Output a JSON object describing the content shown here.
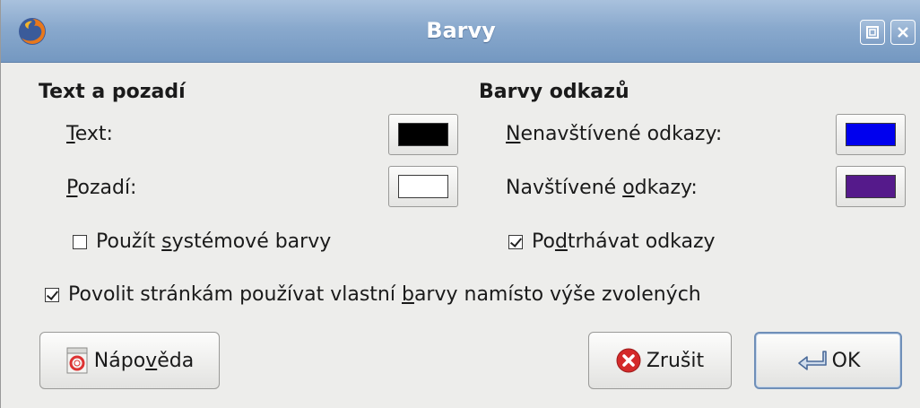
{
  "window": {
    "title": "Barvy"
  },
  "text_background": {
    "heading": "Text a pozadí",
    "text_label_u": "T",
    "text_label_rest": "ext:",
    "bg_label_u": "P",
    "bg_label_rest": "ozadí:",
    "text_color": "#000000",
    "bg_color": "#ffffff",
    "system_colors": {
      "pre": "Použít ",
      "u": "s",
      "post": "ystémové barvy",
      "checked": false
    }
  },
  "link_colors": {
    "heading": "Barvy odkazů",
    "unvisited_u": "N",
    "unvisited_rest": "enavštívené odkazy:",
    "visited_pre": "Navštívené ",
    "visited_u": "o",
    "visited_post": "dkazy:",
    "unvisited_color": "#0000ee",
    "visited_color": "#551a8b",
    "underline": {
      "pre": "Po",
      "u": "d",
      "post": "trhávat odkazy",
      "checked": true
    }
  },
  "allow_page_colors": {
    "pre": "Povolit stránkám používat vlastní ",
    "u": "b",
    "post": "arvy namísto výše zvolených",
    "checked": true
  },
  "buttons": {
    "help": {
      "pre": "Nápo",
      "u": "v",
      "post": "ěda"
    },
    "cancel": "Zrušit",
    "ok": "OK"
  }
}
